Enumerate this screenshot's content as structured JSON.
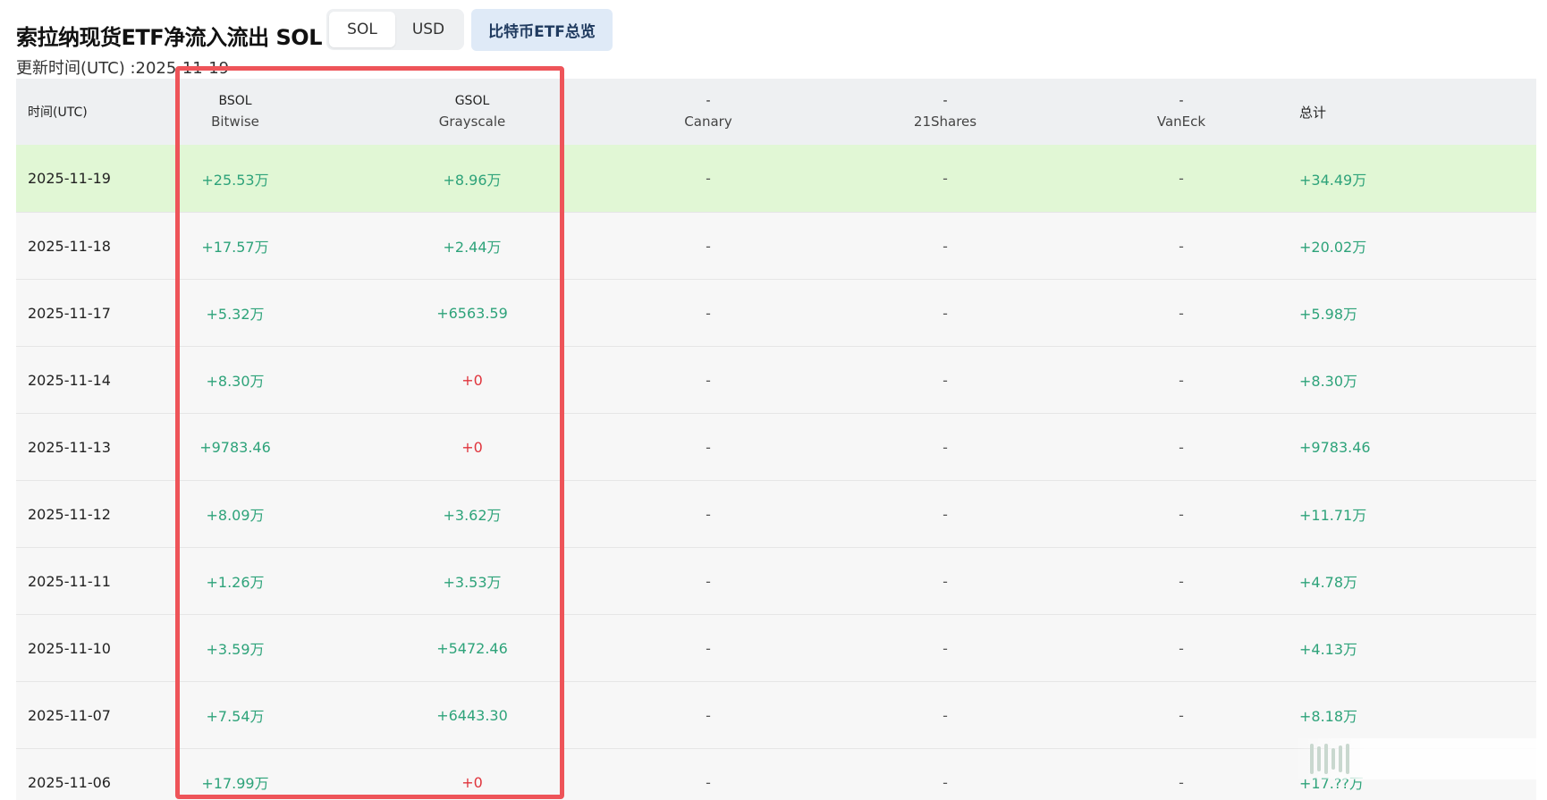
{
  "title": "索拉纳现货ETF净流入流出 SOL",
  "unit_toggle": {
    "options": [
      "SOL",
      "USD"
    ],
    "active": "SOL"
  },
  "btc_overview_label": "比特币ETF总览",
  "updated_text": "更新时间(UTC) :2025-11-19",
  "table": {
    "header": {
      "time": "时间(UTC)",
      "funds": [
        {
          "ticker": "BSOL",
          "issuer": "Bitwise"
        },
        {
          "ticker": "GSOL",
          "issuer": "Grayscale"
        },
        {
          "ticker": "-",
          "issuer": "Canary"
        },
        {
          "ticker": "-",
          "issuer": "21Shares"
        },
        {
          "ticker": "-",
          "issuer": "VanEck"
        }
      ],
      "total": "总计"
    },
    "rows": [
      {
        "date": "2025-11-19",
        "bsol": "+25.53万",
        "gsol": "+8.96万",
        "canary": "-",
        "s21": "-",
        "vaneck": "-",
        "total": "+34.49万"
      },
      {
        "date": "2025-11-18",
        "bsol": "+17.57万",
        "gsol": "+2.44万",
        "canary": "-",
        "s21": "-",
        "vaneck": "-",
        "total": "+20.02万"
      },
      {
        "date": "2025-11-17",
        "bsol": "+5.32万",
        "gsol": "+6563.59",
        "canary": "-",
        "s21": "-",
        "vaneck": "-",
        "total": "+5.98万"
      },
      {
        "date": "2025-11-14",
        "bsol": "+8.30万",
        "gsol": "+0",
        "canary": "-",
        "s21": "-",
        "vaneck": "-",
        "total": "+8.30万"
      },
      {
        "date": "2025-11-13",
        "bsol": "+9783.46",
        "gsol": "+0",
        "canary": "-",
        "s21": "-",
        "vaneck": "-",
        "total": "+9783.46"
      },
      {
        "date": "2025-11-12",
        "bsol": "+8.09万",
        "gsol": "+3.62万",
        "canary": "-",
        "s21": "-",
        "vaneck": "-",
        "total": "+11.71万"
      },
      {
        "date": "2025-11-11",
        "bsol": "+1.26万",
        "gsol": "+3.53万",
        "canary": "-",
        "s21": "-",
        "vaneck": "-",
        "total": "+4.78万"
      },
      {
        "date": "2025-11-10",
        "bsol": "+3.59万",
        "gsol": "+5472.46",
        "canary": "-",
        "s21": "-",
        "vaneck": "-",
        "total": "+4.13万"
      },
      {
        "date": "2025-11-07",
        "bsol": "+7.54万",
        "gsol": "+6443.30",
        "canary": "-",
        "s21": "-",
        "vaneck": "-",
        "total": "+8.18万"
      },
      {
        "date": "2025-11-06",
        "bsol": "+17.99万",
        "gsol": "+0",
        "canary": "-",
        "s21": "-",
        "vaneck": "-",
        "total": "+17.??万"
      }
    ]
  },
  "colors": {
    "positive": "#2ea37a",
    "zero": "#e0343c",
    "highlight_row": "#e1f7d5",
    "annotation_box": "#ee5459"
  }
}
